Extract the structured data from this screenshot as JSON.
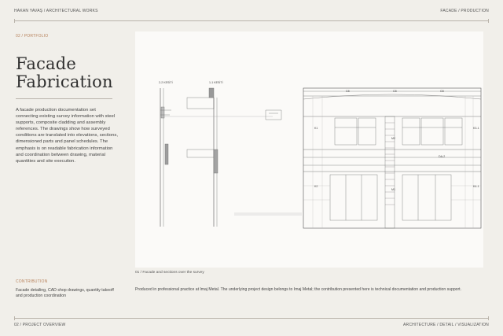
{
  "header": {
    "left": "HAKAN YAVAŞ / ARCHITECTURAL WORKS",
    "right": "FACADE / PRODUCTION"
  },
  "section_label": "02 / PORTFOLIO",
  "title_line1": "Facade",
  "title_line2": "Fabrication",
  "description": "A facade production documentation set connecting existing survey information with steel supports, composite cladding and assembly references. The drawings show how surveyed conditions are translated into elevations, sections, dimensioned parts and panel schedules. The emphasis is on readable fabrication information and coordination between drawing, material quantities and site execution.",
  "contribution": {
    "heading": "CONTRIBUTION",
    "text": "Facade detailing, CAD shop drawings, quantity takeoff and production coordination"
  },
  "drawing": {
    "section_a": "2-2 KESİTİ",
    "section_b": "1-1 KESİTİ",
    "labels": [
      "C8",
      "C8",
      "C8",
      "K1",
      "K2",
      "K3-1",
      "K4-1",
      "M2",
      "M1",
      "DA-2"
    ],
    "caption": "01 / Facade and sections over the survey"
  },
  "note": "Produced in professional practice at Imaj Metal. The underlying project design belongs to Imaj Metal; the contribution presented here is technical documentation and production support.",
  "footer": {
    "left": "02 / PROJECT OVERVIEW",
    "right": "ARCHITECTURE / DETAIL / VISUALIZATION"
  },
  "colors": {
    "background": "#f1efea",
    "panel": "#fbfaf8",
    "accent": "#b7825c",
    "rule": "#b9b3aa"
  }
}
